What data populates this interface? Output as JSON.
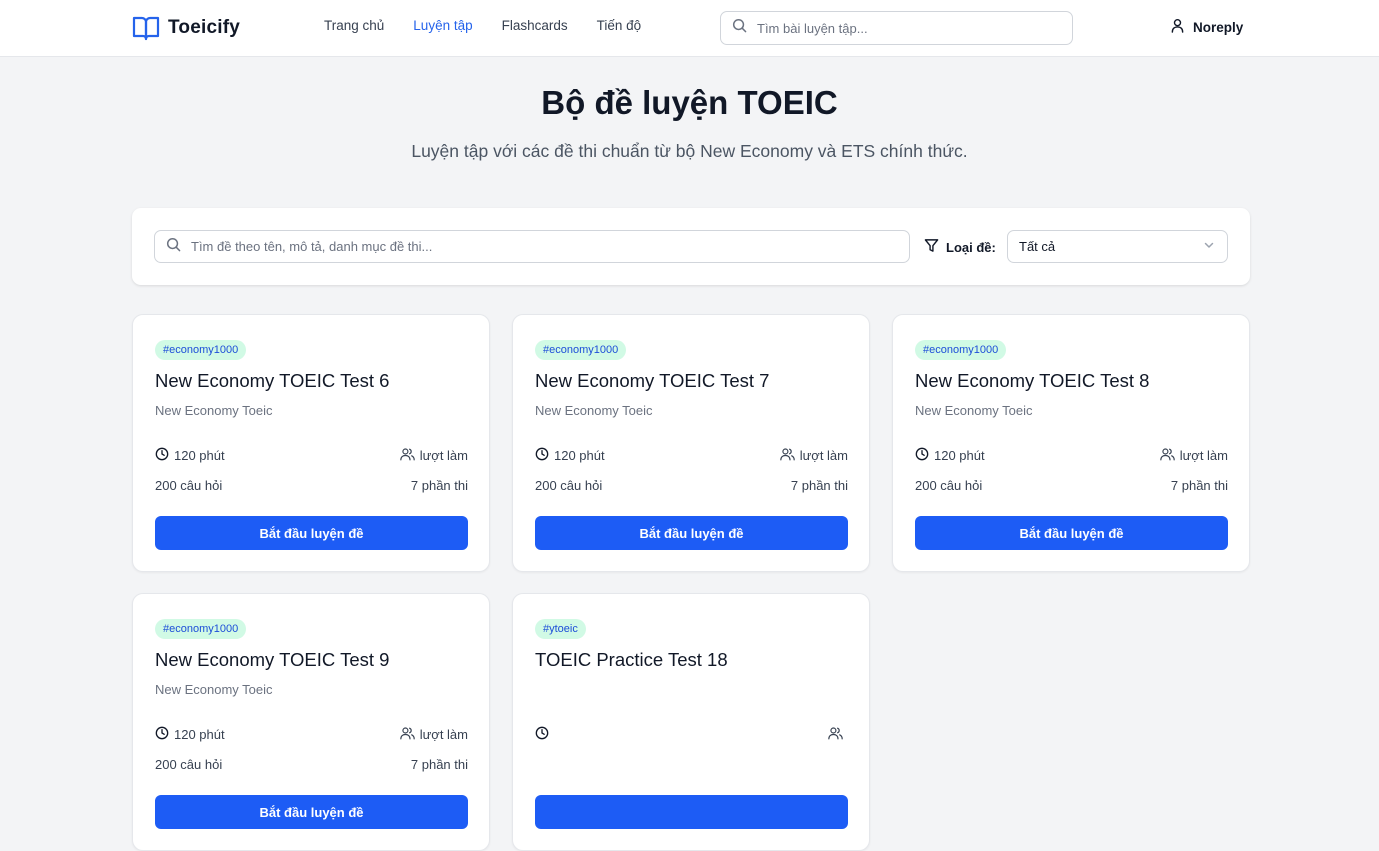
{
  "header": {
    "brand": "Toeicify",
    "nav": [
      "Trang chủ",
      "Luyện tập",
      "Flashcards",
      "Tiến độ"
    ],
    "active_nav": 1,
    "search_placeholder": "Tìm bài luyện tập...",
    "user_name": "Noreply"
  },
  "hero": {
    "title": "Bộ đề luyện TOEIC",
    "subtitle": "Luyện tập với các đề thi chuẩn từ bộ New Economy và ETS chính thức."
  },
  "filter": {
    "search_placeholder": "Tìm đề theo tên, mô tả, danh mục đề thi...",
    "type_label": "Loại đề:",
    "type_value": "Tất cả"
  },
  "colors": {
    "accent": "#1d5cf5",
    "tag_bg": "#d1fae5",
    "tag_text": "#1d4ed8"
  },
  "cards": [
    {
      "tag": "#economy1000",
      "title": "New Economy TOEIC Test 6",
      "subtitle": "New Economy Toeic",
      "duration": "120 phút",
      "attempts": "lượt làm",
      "questions": "200 câu hỏi",
      "parts": "7 phần thi",
      "button": "Bắt đầu luyện đề"
    },
    {
      "tag": "#economy1000",
      "title": "New Economy TOEIC Test 7",
      "subtitle": "New Economy Toeic",
      "duration": "120 phút",
      "attempts": "lượt làm",
      "questions": "200 câu hỏi",
      "parts": "7 phần thi",
      "button": "Bắt đầu luyện đề"
    },
    {
      "tag": "#economy1000",
      "title": "New Economy TOEIC Test 8",
      "subtitle": "New Economy Toeic",
      "duration": "120 phút",
      "attempts": "lượt làm",
      "questions": "200 câu hỏi",
      "parts": "7 phần thi",
      "button": "Bắt đầu luyện đề"
    },
    {
      "tag": "#economy1000",
      "title": "New Economy TOEIC Test 9",
      "subtitle": "New Economy Toeic",
      "duration": "120 phút",
      "attempts": "lượt làm",
      "questions": "200 câu hỏi",
      "parts": "7 phần thi",
      "button": "Bắt đầu luyện đề"
    },
    {
      "tag": "#ytoeic",
      "title": "TOEIC Practice Test 18",
      "subtitle": "",
      "duration": "",
      "attempts": "",
      "questions": "",
      "parts": "",
      "button": ""
    }
  ]
}
